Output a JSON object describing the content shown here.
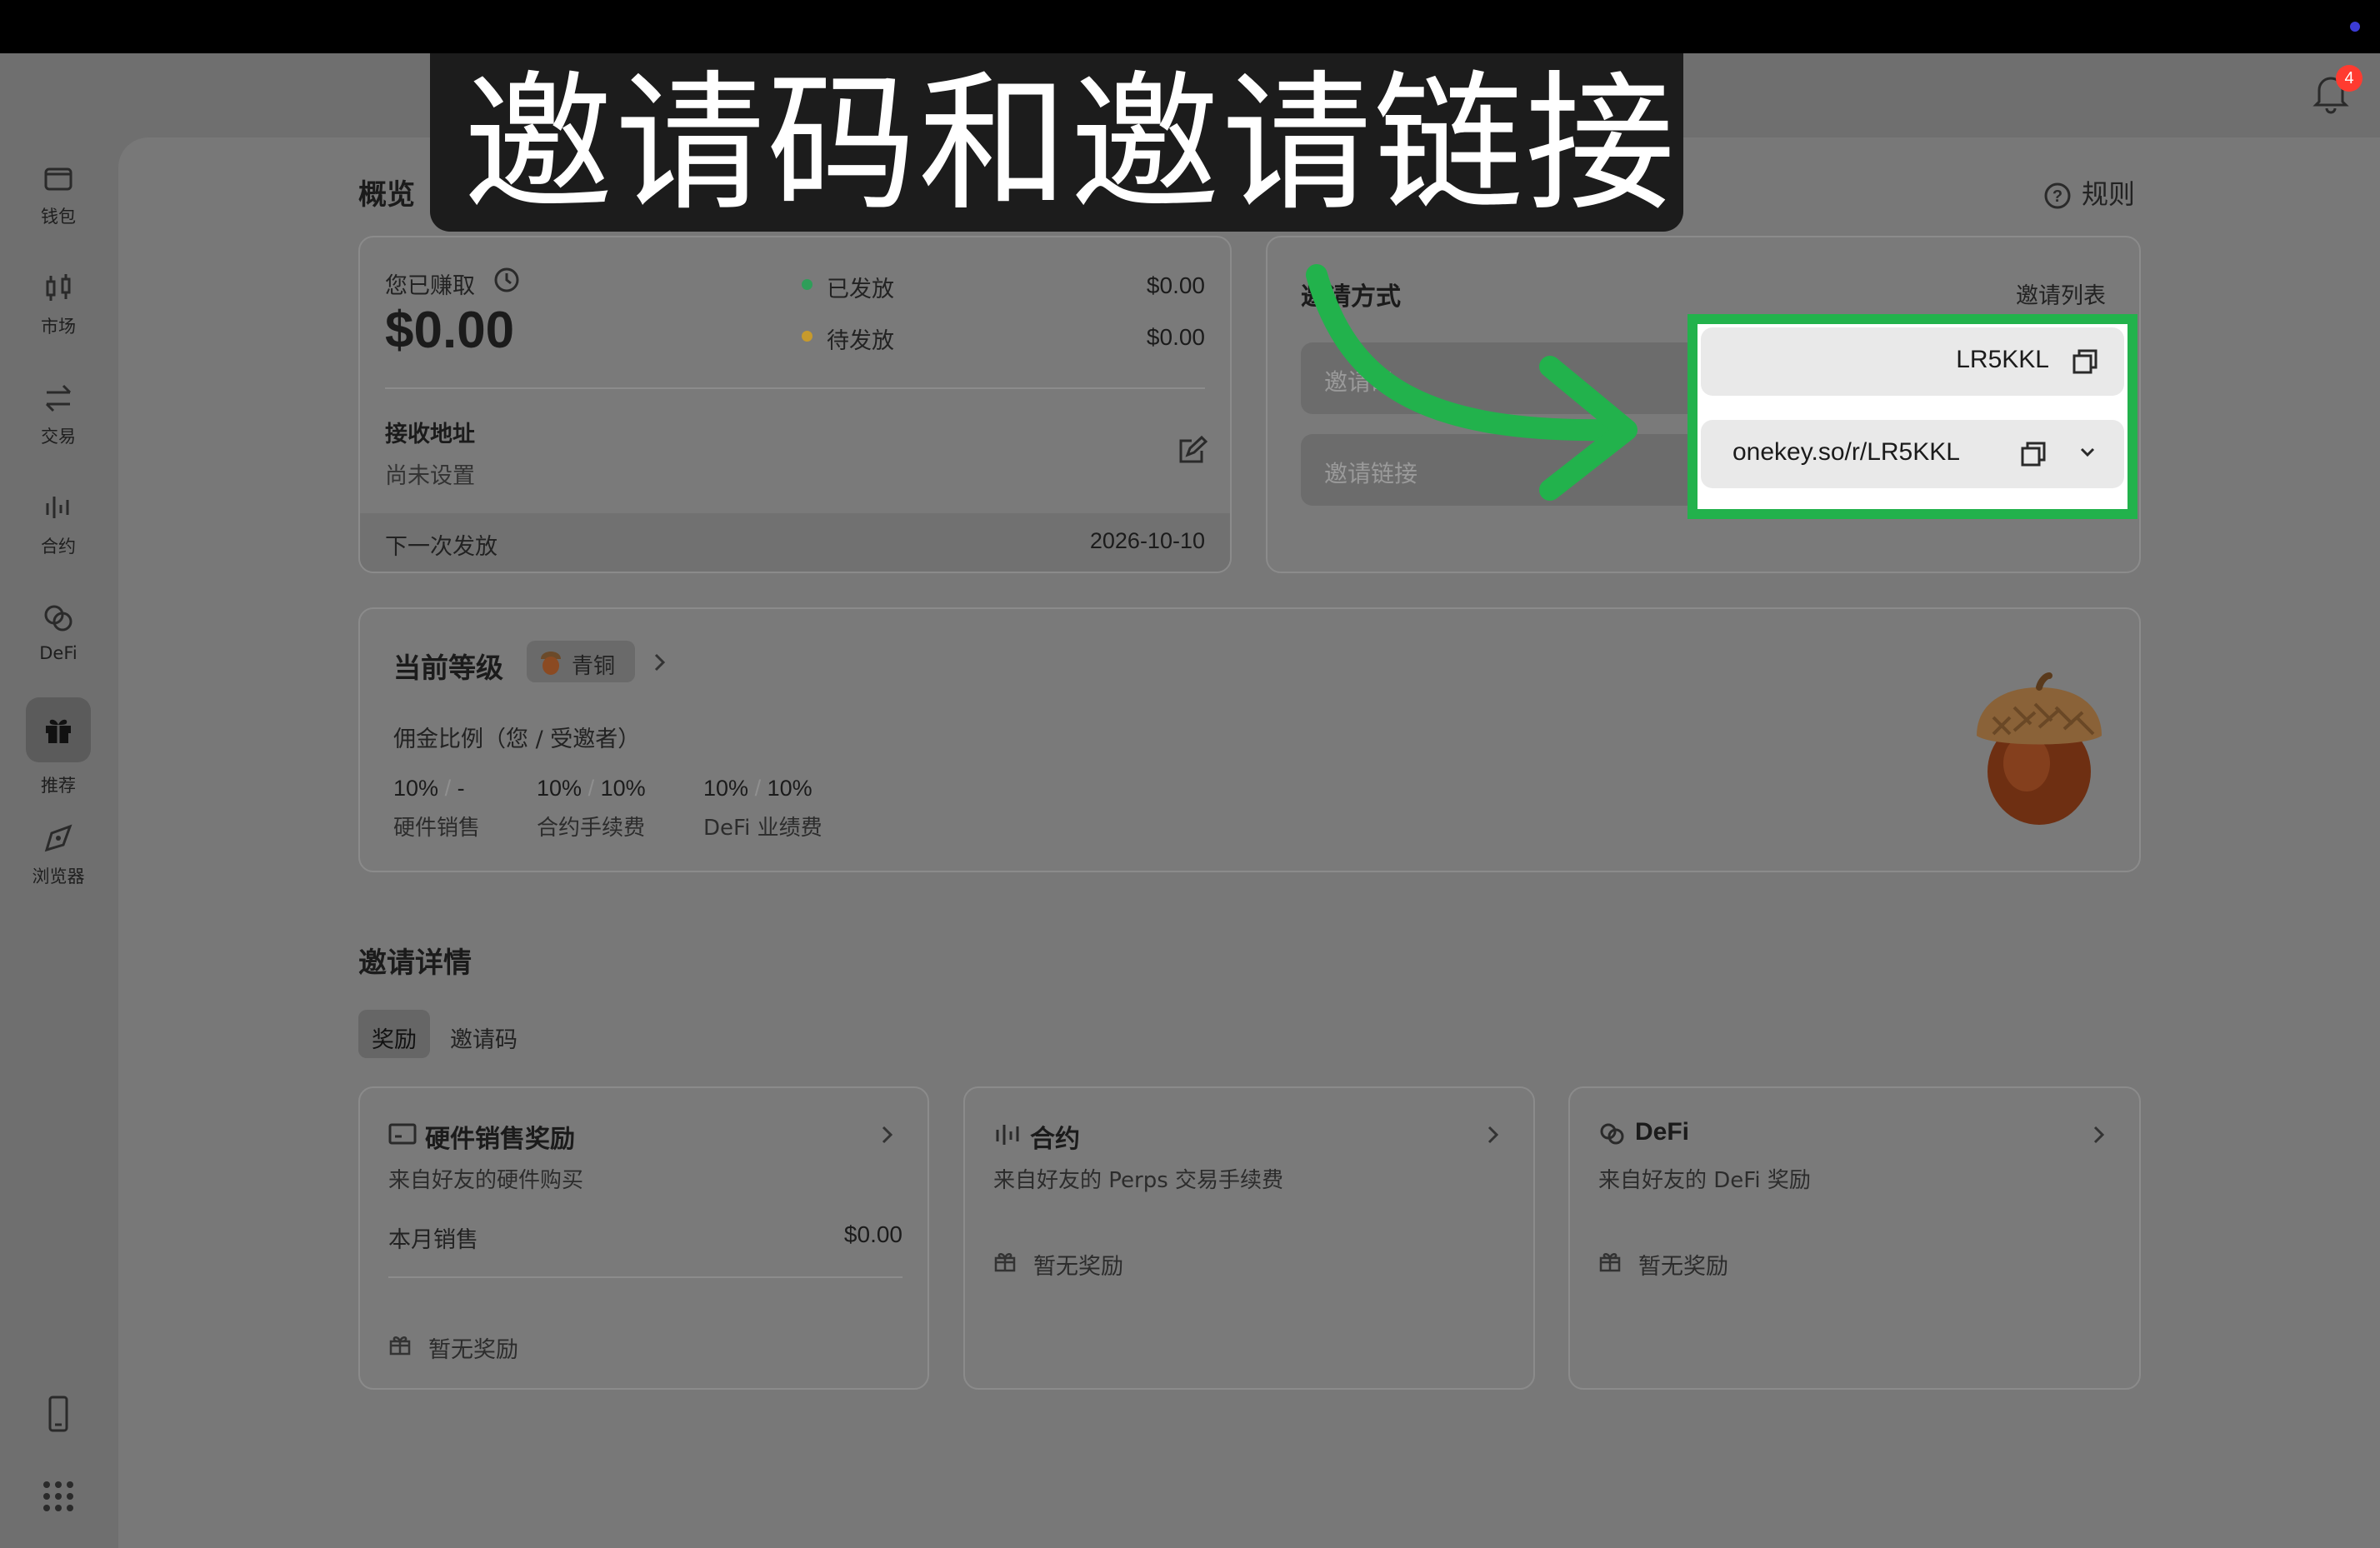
{
  "caption": "邀请码和邀请链接",
  "notifications": {
    "count": "4"
  },
  "sidebar": {
    "items": [
      {
        "label": "钱包",
        "icon": "wallet-icon"
      },
      {
        "label": "市场",
        "icon": "candlestick-icon"
      },
      {
        "label": "交易",
        "icon": "swap-icon"
      },
      {
        "label": "合约",
        "icon": "perps-icon"
      },
      {
        "label": "DeFi",
        "icon": "defi-icon"
      },
      {
        "label": "推荐",
        "icon": "gift-icon",
        "active": true
      },
      {
        "label": "浏览器",
        "icon": "compass-icon"
      }
    ],
    "bottom_icons": [
      "device-icon",
      "apps-grid-icon"
    ]
  },
  "overview": {
    "title": "概览",
    "rules_label": "规则",
    "earned_label": "您已赚取",
    "earned_value": "$0.00",
    "issued_label": "已发放",
    "issued_value": "$0.00",
    "pending_label": "待发放",
    "pending_value": "$0.00",
    "address_label": "接收地址",
    "address_value": "尚未设置",
    "next_payout_label": "下一次发放",
    "next_payout_date": "2026-10-10"
  },
  "invite": {
    "title": "邀请方式",
    "list_link": "邀请列表",
    "code_label": "邀请码",
    "code_value": "LR5KKL",
    "link_label": "邀请链接",
    "link_value": "onekey.so/r/LR5KKL"
  },
  "level": {
    "title": "当前等级",
    "badge": "青铜",
    "commission_label": "佣金比例（您 / 受邀者）",
    "rates": [
      {
        "you": "10%",
        "sep": "/",
        "invitee": "-",
        "label": "硬件销售"
      },
      {
        "you": "10%",
        "sep": "/",
        "invitee": "10%",
        "label": "合约手续费"
      },
      {
        "you": "10%",
        "sep": "/",
        "invitee": "10%",
        "label": "DeFi 业绩费"
      }
    ]
  },
  "details": {
    "title": "邀请详情",
    "tabs": [
      "奖励",
      "邀请码"
    ],
    "cards": [
      {
        "title": "硬件销售奖励",
        "subtitle": "来自好友的硬件购买",
        "row_label": "本月销售",
        "row_value": "$0.00",
        "empty": "暂无奖励",
        "icon": "hardware-icon"
      },
      {
        "title": "合约",
        "subtitle": "来自好友的 Perps 交易手续费",
        "empty": "暂无奖励",
        "icon": "perps-icon"
      },
      {
        "title": "DeFi",
        "subtitle": "来自好友的 DeFi 奖励",
        "empty": "暂无奖励",
        "icon": "defi-icon"
      }
    ]
  },
  "colors": {
    "highlight": "#22b24c",
    "arrow": "#22b24c",
    "issued_dot": "#2f9e59",
    "pending_dot": "#c79a2c",
    "badge": "#ff3b30"
  }
}
